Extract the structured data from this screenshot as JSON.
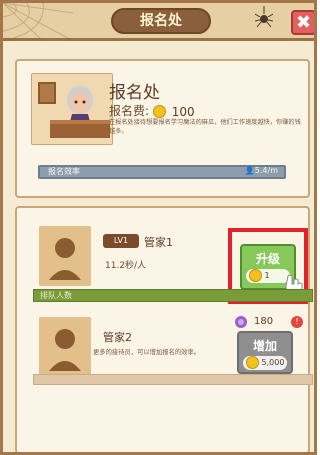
{
  "header": {
    "title": "报名处",
    "close_glyph": "✖"
  },
  "registration": {
    "title": "报名处",
    "fee_label": "报名费:",
    "fee_value": "100",
    "description": "在报名处接待想要报名学习魔法的麻瓜，他们工作速度越快，你赚的钱越多。",
    "efficiency_label": "报名效率",
    "efficiency_value": "👤5.4/m"
  },
  "staff": {
    "lv_label": "LV1",
    "name1": "管家1",
    "rate1": "11.2秒/人",
    "queue_label": "排队人数",
    "upgrade_label": "升级",
    "upgrade_cost": "1",
    "name2": "管家2",
    "description2": "更多的接待员，可以增加报名的效率。",
    "gem_value": "180",
    "alert_glyph": "!",
    "add_label": "增加",
    "add_cost": "5,000"
  },
  "icons": {
    "close": "close-icon",
    "spider": "spider-icon",
    "coin": "coin-icon",
    "gem": "gem-icon",
    "person": "person-icon",
    "hand": "hand-pointer-icon"
  },
  "colors": {
    "upgrade_green": "#86c85a",
    "highlight_red": "#e3212a",
    "queue_green": "#7a9b3a",
    "efficiency_gray": "#8d9dab",
    "disabled_gray": "#8f8f8f"
  }
}
